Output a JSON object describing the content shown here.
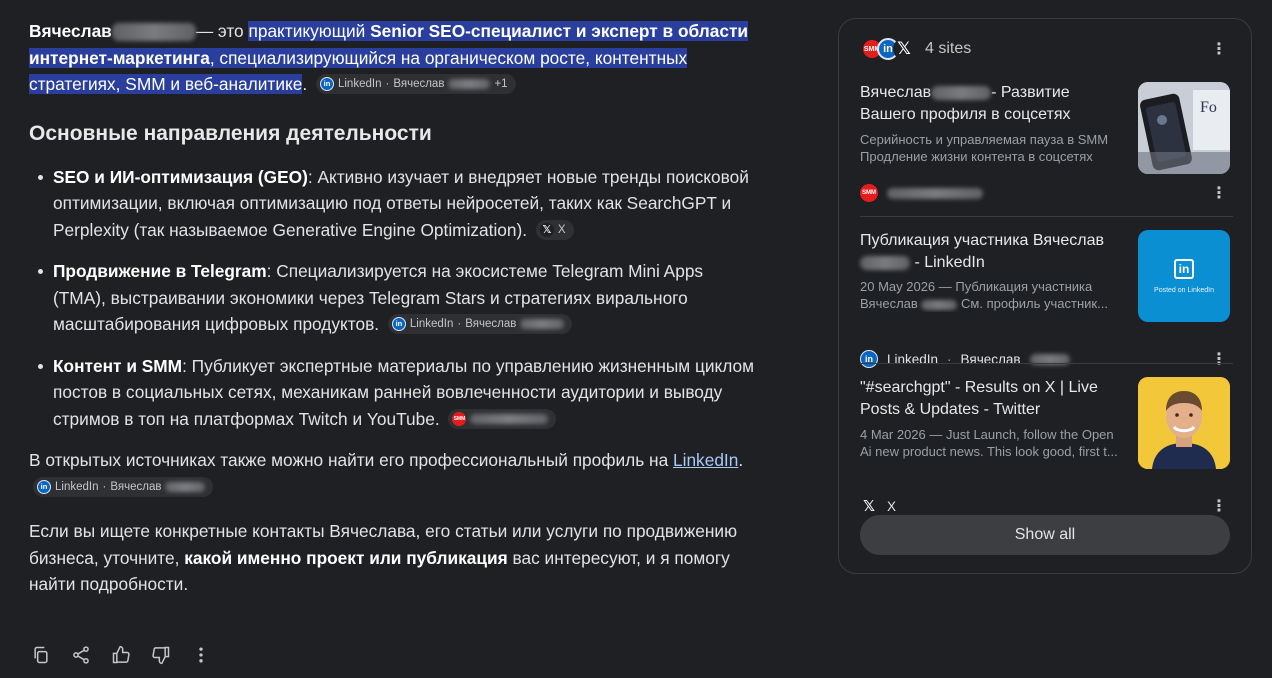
{
  "answer": {
    "intro": {
      "name": "Вячеслав",
      "dash": "— это ",
      "h1": "практикующий ",
      "h2": "Senior SEO-специалист и эксперт в области интернет-маркетинга",
      "h3": ", специализирующийся на органическом росте, контентных стратегиях, SMM и веб-аналитике",
      "end": ".",
      "chip": {
        "source": "LinkedIn",
        "name": "Вячеслав",
        "more": "+1"
      }
    },
    "heading": "Основные направления деятельности",
    "items": [
      {
        "title": "SEO и ИИ-оптимизация (GEO)",
        "text": ": Активно изучает и внедряет новые тренды поисковой оптимизации, включая оптимизацию под ответы нейросетей, таких как SearchGPT и Perplexity (так называемое Generative Engine Optimization).",
        "chip": {
          "source": "X"
        }
      },
      {
        "title": "Продвижение в Telegram",
        "text": ": Специализируется на экосистеме Telegram Mini Apps (TMA), выстраивании экономики через Telegram Stars и стратегиях вирального масштабирования цифровых продуктов.",
        "chip": {
          "source": "LinkedIn",
          "name": "Вячеслав"
        }
      },
      {
        "title": "Контент и SMM",
        "text": ": Публикует экспертные материалы по управлению жизненным циклом постов в социальных сетях, механикам ранней вовлеченности аудитории и выводу стримов в топ на платформах Twitch и YouTube.",
        "chip": {
          "source": "SMM"
        }
      }
    ],
    "para2": {
      "text": "В открытых источниках также можно найти его профессиональный профиль на ",
      "link": "LinkedIn",
      "end": ".",
      "chip": {
        "source": "LinkedIn",
        "name": "Вячеслав"
      }
    },
    "para3": {
      "a": "Если вы ищете конкретные контакты Вячеслава, его статьи или услуги по продвижению бизнеса, уточните, ",
      "b": "какой именно проект или публикация",
      "c": " вас интересуют, и я помогу найти подробности."
    }
  },
  "actions": [
    "copy-icon",
    "share-icon",
    "thumbs-up-icon",
    "thumbs-down-icon",
    "more-vert-icon"
  ],
  "sources": {
    "count_label": "4 sites",
    "cards": [
      {
        "title": "Вячеслав — Развитие Вашего профиля в соцсетях",
        "title_a": "Вячеслав",
        "title_b": "- Развитие Вашего профиля в соцсетях",
        "snippet1": "Серийность и управляемая пауза в SMM",
        "snippet2": "Продление жизни контента в соцсетях",
        "source": "",
        "icon": "smm-icon"
      },
      {
        "title_a": "Публикация участника Вячеслав",
        "title_b": "- LinkedIn",
        "snippet1": "20 May 2026 — Публикация участника",
        "snippet2": "Вячеслав",
        "snippet2b": "См. профиль участник...",
        "thumb_text": "Posted on LinkedIn",
        "thumb_logo": "in",
        "source": "LinkedIn",
        "source_name": "Вячеслав",
        "icon": "linkedin-icon"
      },
      {
        "title": "\"#searchgpt\" - Results on X | Live Posts & Updates - Twitter",
        "snippet1": "4 Mar 2026 — Just Launch, follow the Open",
        "snippet2": "Ai new product news. This look good, first t...",
        "source": "X",
        "icon": "x-icon"
      }
    ],
    "show_all": "Show all"
  },
  "colors": {
    "background": "#1f2023",
    "highlight": "#2a3f9d",
    "link": "#a8c7fa",
    "linkedin": "#0a66c2",
    "smm": "#e51c1c"
  }
}
